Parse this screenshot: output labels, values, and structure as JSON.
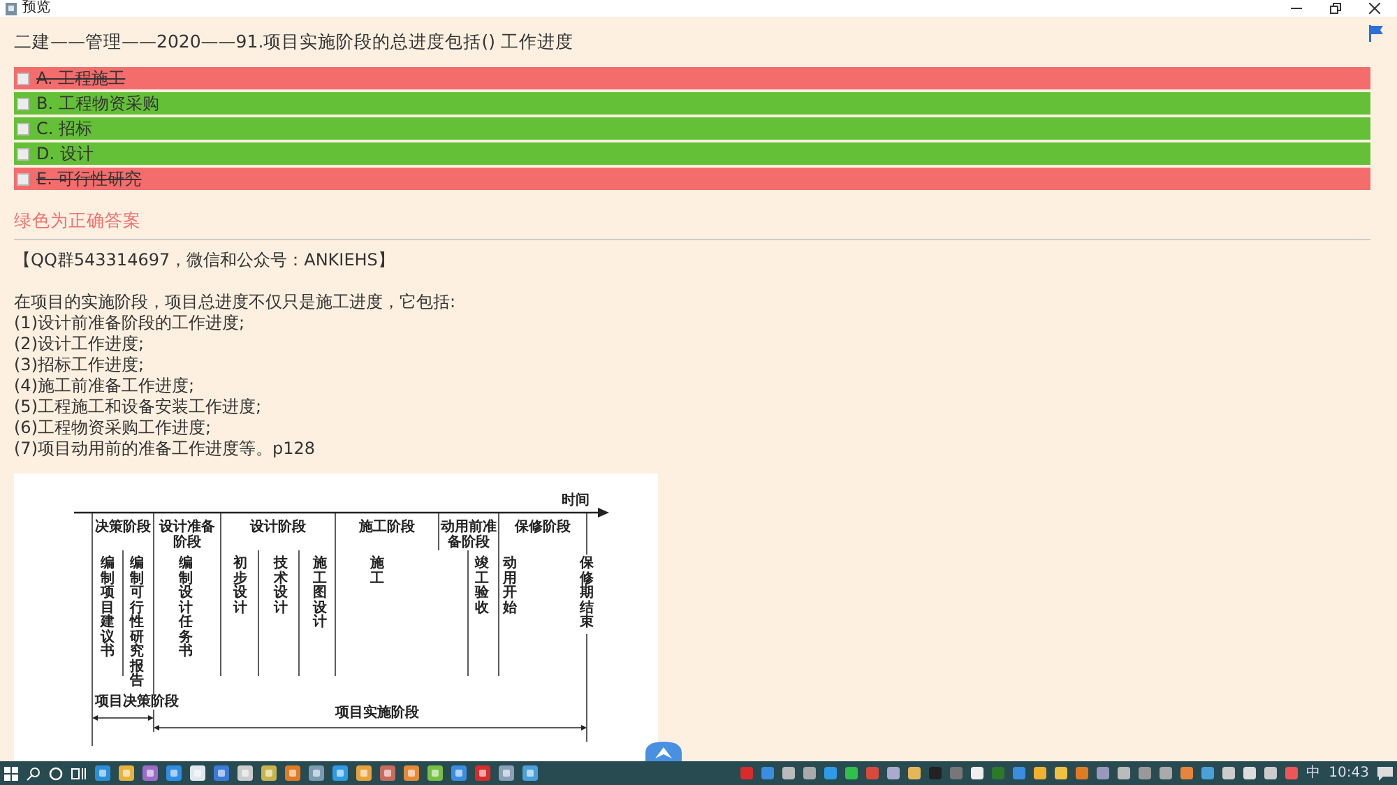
{
  "window": {
    "title": "预览"
  },
  "flagged": true,
  "question": "二建——管理——2020——91.项目实施阶段的总进度包括()  工作进度",
  "options": [
    {
      "label": "A. 工程施工",
      "checked": false,
      "correct": false
    },
    {
      "label": "B. 工程物资采购",
      "checked": false,
      "correct": true
    },
    {
      "label": "C. 招标",
      "checked": false,
      "correct": true
    },
    {
      "label": "D. 设计",
      "checked": false,
      "correct": true
    },
    {
      "label": "E. 可行性研究",
      "checked": false,
      "correct": false
    }
  ],
  "answer_note": "绿色为正确答案",
  "source": "【QQ群543314697，微信和公众号：ANKIEHS】",
  "explanation": [
    "在项目的实施阶段，项目总进度不仅只是施工进度，它包括:",
    "(1)设计前准备阶段的工作进度;",
    "(2)设计工作进度;",
    "(3)招标工作进度;",
    "(4)施工前准备工作进度;",
    "(5)工程施工和设备安装工作进度;",
    "(6)工程物资采购工作进度;",
    "(7)项目动用前的准备工作进度等。p128"
  ],
  "figure": {
    "axis_label": "时间",
    "phases": [
      "决策阶段",
      "设计准备阶段",
      "设计阶段",
      "施工阶段",
      "动用前准备阶段",
      "保修阶段"
    ],
    "tasks": [
      "编制项目建议书",
      "编制可行性研究报告",
      "编制设计任务书",
      "初步设计",
      "技术设计",
      "施工图设计",
      "施工",
      "竣工验收",
      "动用开始",
      "保修期结束"
    ],
    "spans": [
      "项目决策阶段",
      "项目实施阶段"
    ]
  },
  "taskbar": {
    "input_method": "中",
    "time": "10:43"
  }
}
